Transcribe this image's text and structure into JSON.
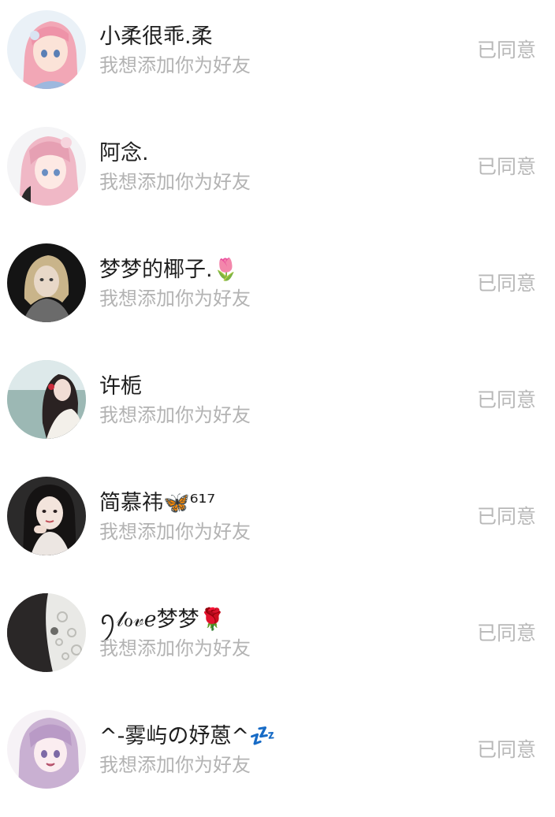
{
  "requests": [
    {
      "name": "小柔很乖.柔",
      "message": "我想添加你为好友",
      "status": "已同意",
      "avatar": "anime-pink-hair-girl"
    },
    {
      "name": "阿念.",
      "message": "我想添加你为好友",
      "status": "已同意",
      "avatar": "anime-pink-hair-girl-2"
    },
    {
      "name": "梦梦的椰子.🌷",
      "message": "我想添加你为好友",
      "status": "已同意",
      "avatar": "blonde-girl-photo"
    },
    {
      "name": "许栀",
      "message": "我想添加你为好友",
      "status": "已同意",
      "avatar": "girl-by-sea-photo"
    },
    {
      "name": "简慕祎🦋⁶¹⁷",
      "message": "我想添加你为好友",
      "status": "已同意",
      "avatar": "dark-hair-girl-photo"
    },
    {
      "name": "ꪆ𝓁ℴ𝓋ℯ梦梦🌹",
      "message": "我想添加你为好友",
      "status": "已同意",
      "avatar": "girl-with-lace-photo"
    },
    {
      "name": "^-雾屿の妤蒽^💤",
      "message": "我想添加你为好友",
      "status": "已同意",
      "avatar": "anime-purple-hair-girl"
    }
  ],
  "colors": {
    "name": "#1f1f1f",
    "message": "#b3b3b3",
    "status": "#b8b8b8",
    "background": "#ffffff"
  }
}
